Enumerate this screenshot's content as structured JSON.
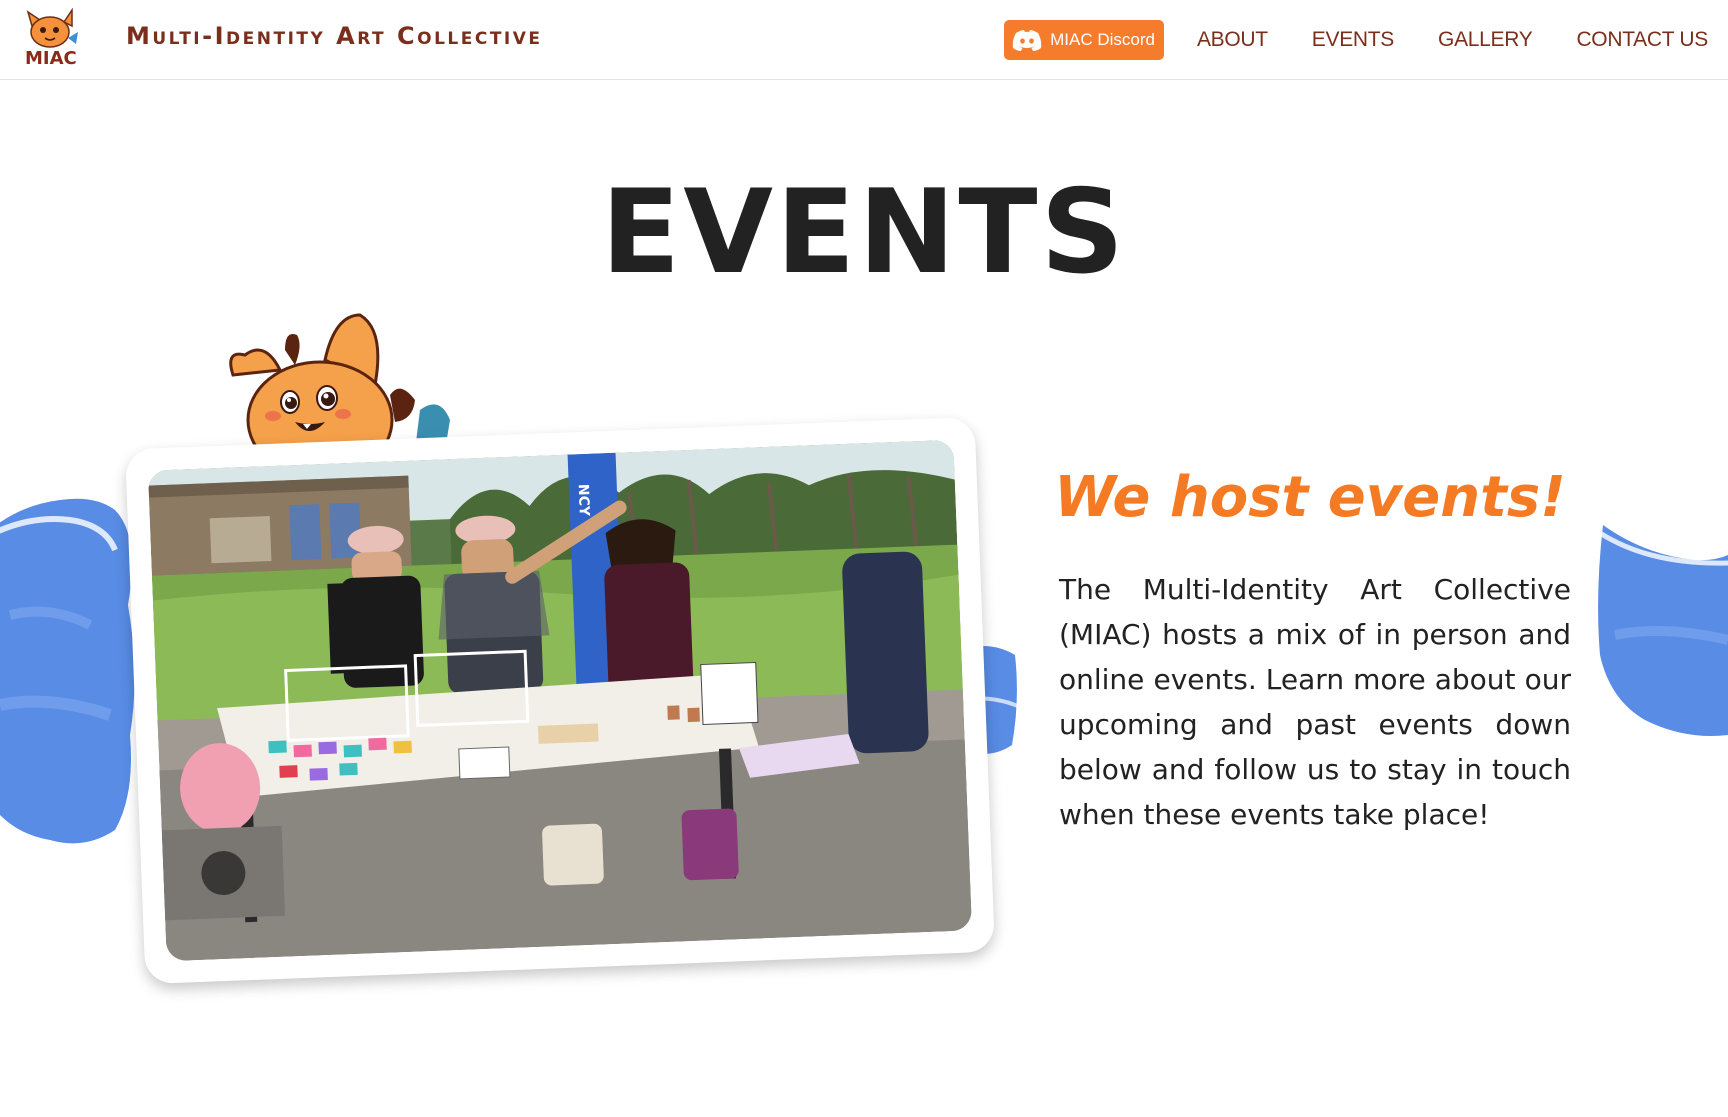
{
  "header": {
    "site_title": "Multi-Identity Art Collective",
    "logo_text": "MIAC",
    "discord_label": "MIAC Discord",
    "nav": [
      "ABOUT",
      "EVENTS",
      "GALLERY",
      "CONTACT US"
    ]
  },
  "main": {
    "title": "EVENTS",
    "subtitle": "We host events!",
    "description": "The Multi-Identity Art Collective (MIAC) hosts a mix of in person and online events. Learn more about our upcoming and past events down below and follow us to stay in touch when these events take place!",
    "photo_sign_text": "NCY"
  },
  "colors": {
    "brand_brown": "#7a2f1c",
    "accent_orange": "#f57c2c",
    "blob_blue": "#3b78e0",
    "title_dark": "#222222"
  },
  "icons": {
    "discord": "discord-icon",
    "mascot": "fox-mascot",
    "logo": "miac-fox-logo"
  }
}
